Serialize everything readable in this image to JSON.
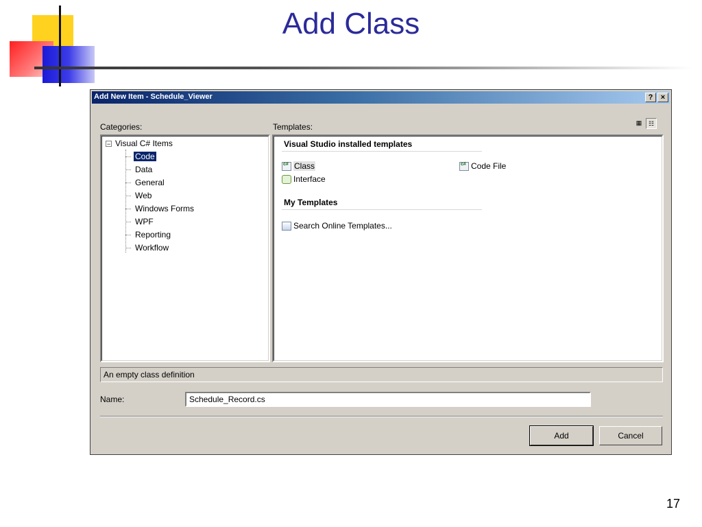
{
  "slide": {
    "title": "Add Class",
    "page_number": "17"
  },
  "dialog": {
    "title": "Add New Item - Schedule_Viewer",
    "help_button": "?",
    "close_button": "×",
    "categories_label": "Categories:",
    "templates_label": "Templates:",
    "tree": {
      "root": "Visual C# Items",
      "toggle": "−",
      "items": [
        "Code",
        "Data",
        "General",
        "Web",
        "Windows Forms",
        "WPF",
        "Reporting",
        "Workflow"
      ],
      "selected": "Code"
    },
    "templates": {
      "installed_heading": "Visual Studio installed templates",
      "installed": [
        {
          "label": "Class",
          "icon": "csharp-class-icon",
          "selected": true
        },
        {
          "label": "Code File",
          "icon": "csharp-code-file-icon"
        },
        {
          "label": "Interface",
          "icon": "interface-icon"
        }
      ],
      "my_heading": "My Templates",
      "my": [
        {
          "label": "Search Online Templates...",
          "icon": "search-online-icon"
        }
      ]
    },
    "view_buttons": {
      "large": "▦",
      "small": "☷"
    },
    "description": "An empty class definition",
    "name_label": "Name:",
    "name_value": "Schedule_Record.cs",
    "buttons": {
      "add": "Add",
      "cancel": "Cancel"
    }
  },
  "colors": {
    "title_text": "#2b2b9a",
    "titlebar_start": "#0a246a",
    "titlebar_end": "#a6caf0",
    "dialog_bg": "#d4d0c8",
    "selection": "#0a246a"
  }
}
